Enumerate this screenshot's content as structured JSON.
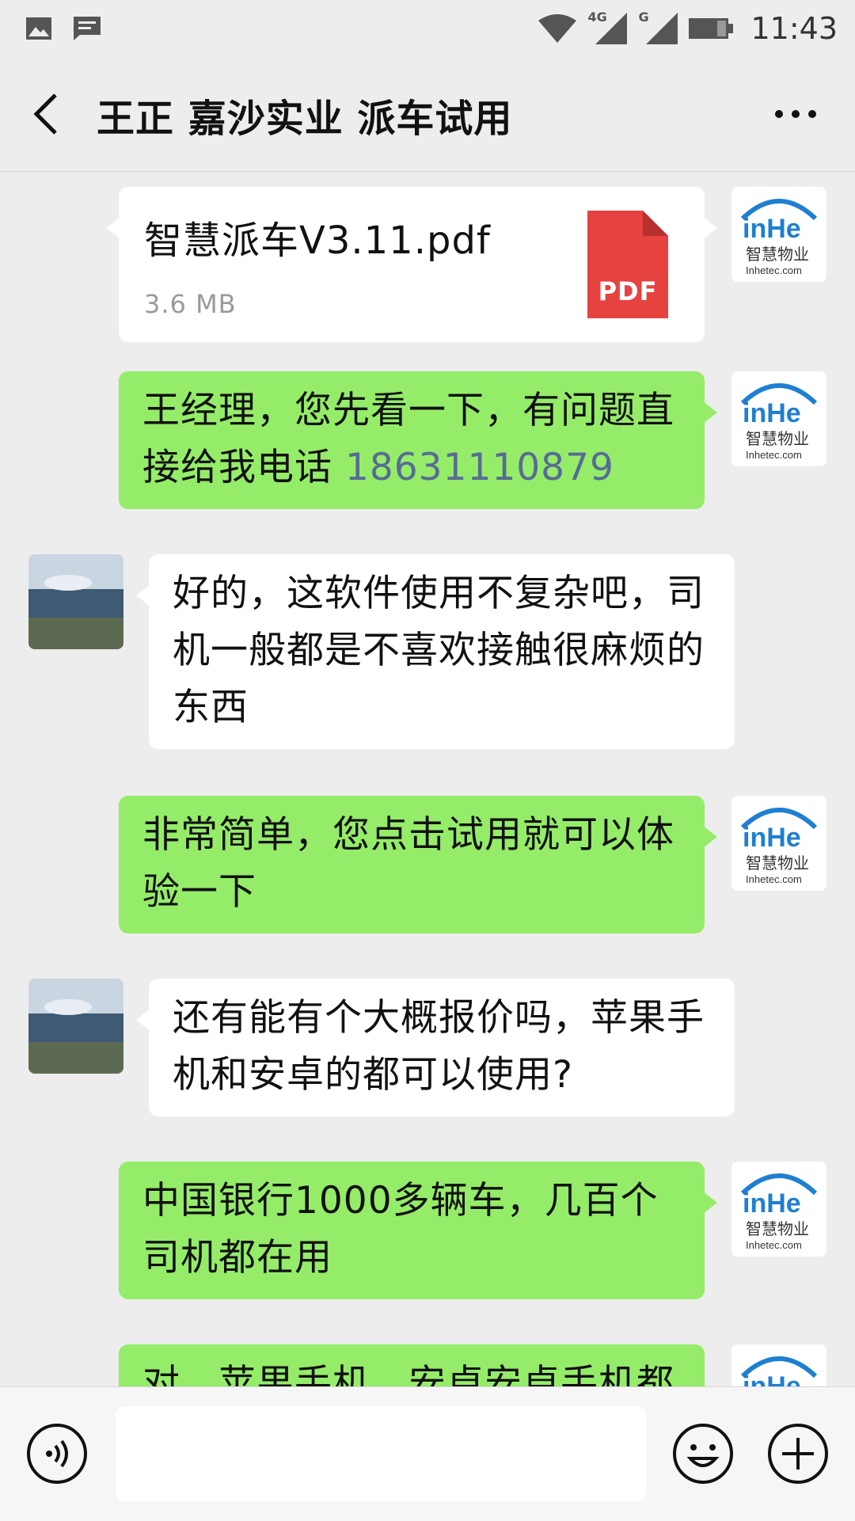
{
  "status_bar": {
    "time": "11:43",
    "network_4g": "4G",
    "network_g": "G",
    "icons": [
      "gallery-icon",
      "message-icon",
      "wifi-icon",
      "signal-4g-icon",
      "signal-g-icon",
      "battery-icon"
    ]
  },
  "header": {
    "title": "王正 嘉沙实业 派车试用",
    "icons": [
      "back-arrow-icon",
      "more-icon"
    ]
  },
  "brand_avatar": {
    "logo_text": "inHe",
    "logo_cn": "智慧物业",
    "logo_url": "Inhetec.com",
    "colors": {
      "blue": "#1f7fd0",
      "dark": "#333333"
    }
  },
  "messages": [
    {
      "side": "right",
      "type": "file",
      "file_name": "智慧派车V3.11.pdf",
      "file_size": "3.6 MB",
      "file_badge": "PDF"
    },
    {
      "side": "right",
      "type": "text",
      "text": "王经理，您先看一下，有问题直接给我电话 ",
      "link": "18631110879"
    },
    {
      "side": "left",
      "type": "text",
      "text": "好的，这软件使用不复杂吧，司机一般都是不喜欢接触很麻烦的东西"
    },
    {
      "side": "right",
      "type": "text",
      "text": "非常简单，您点击试用就可以体验一下"
    },
    {
      "side": "left",
      "type": "text",
      "text": "还有能有个大概报价吗，苹果手机和安卓的都可以使用?"
    },
    {
      "side": "right",
      "type": "text",
      "text": "中国银行1000多辆车，几百个司机都在用"
    },
    {
      "side": "right",
      "type": "text",
      "text": "对，苹果手机，安卓安卓手机都"
    }
  ],
  "input_bar": {
    "value": "",
    "icons": [
      "voice-icon",
      "emoji-icon",
      "plus-icon"
    ]
  },
  "colors": {
    "background": "#ededed",
    "bubble_self": "#95ec69",
    "bubble_other": "#ffffff",
    "link": "#576b95",
    "pdf_red": "#e64340"
  }
}
